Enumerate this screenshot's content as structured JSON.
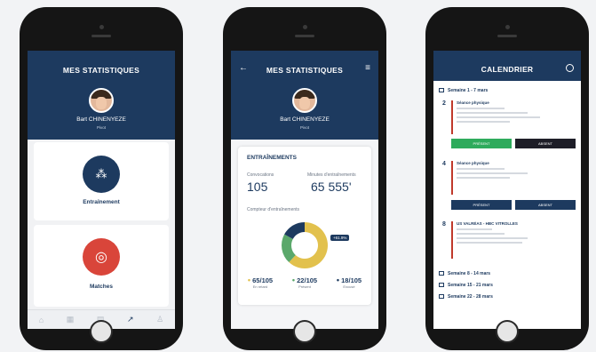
{
  "phone1": {
    "title": "MES STATISTIQUES",
    "player_name": "Bart CHINENYEZE",
    "player_role": "Pivot",
    "card1_label": "Entraînement",
    "card2_label": "Matches",
    "tabs": [
      "⌂",
      "▦",
      "▤",
      "↗",
      "♙"
    ]
  },
  "phone2": {
    "title": "MES STATISTIQUES",
    "back_icon": "←",
    "filter_icon": "≡",
    "player_name": "Bart CHINENYEZE",
    "player_role": "Pivot",
    "section_title": "ENTRAÎNEMENTS",
    "stat1_label": "Convocations",
    "stat1_value": "105",
    "stat2_label": "Minutes d'entraînements",
    "stat2_value": "65 555'",
    "chart_title": "Compteur d'entraînements",
    "tooltip": "+61.9%",
    "legend": [
      {
        "value": "65/105",
        "label": "En retard",
        "color": "#e2c14d"
      },
      {
        "value": "22/105",
        "label": "Présent",
        "color": "#5ba86b"
      },
      {
        "value": "18/105",
        "label": "Excusé",
        "color": "#1d3a5f"
      }
    ]
  },
  "phone3": {
    "title": "CALENDRIER",
    "week1": "Semaine 1 - 7 mars",
    "event1": {
      "day": "2",
      "title": "Séance physique"
    },
    "event2": {
      "day": "4",
      "title": "Séance physique"
    },
    "event3": {
      "day": "8",
      "title": "US VALRÉAS - HBC VITROLLES"
    },
    "btn_present": "PRÉSENT",
    "btn_absent": "ABSENT",
    "week2": "Semaine 8 - 14 mars",
    "week3": "Semaine 15 - 21 mars",
    "week4": "Semaine 22 - 28 mars"
  }
}
